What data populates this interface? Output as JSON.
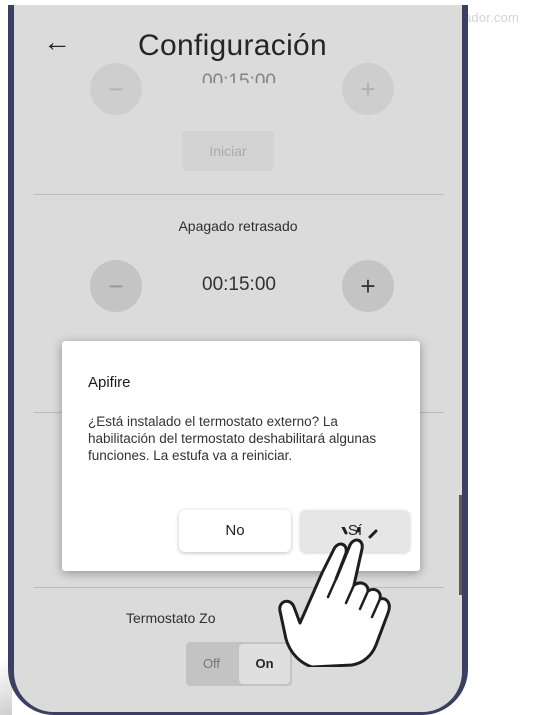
{
  "watermark": "ador.com",
  "appbar": {
    "title": "Configuración",
    "back_icon": "arrow-left-icon"
  },
  "top_section": {
    "time_partial": "00:15:00",
    "minus_icon": "minus-icon",
    "plus_icon": "plus-icon",
    "start_label": "Iniciar"
  },
  "delayed_off": {
    "title": "Apagado retrasado",
    "time": "00:15:00",
    "minus_icon": "minus-icon",
    "plus_icon": "plus-icon"
  },
  "zone_thermostat": {
    "title_visible": "Termostato Zo",
    "off_label": "Off",
    "on_label": "On",
    "selected": "On"
  },
  "dialog": {
    "title": "Apifire",
    "body": "¿Está instalado el termostato externo? La habilitación del termostato deshabilitará algunas funciones. La estufa va a reiniciar.",
    "no_label": "No",
    "yes_label": "Sí"
  },
  "colors": {
    "phone_frame": "#3b3f63",
    "background": "#ededed"
  }
}
